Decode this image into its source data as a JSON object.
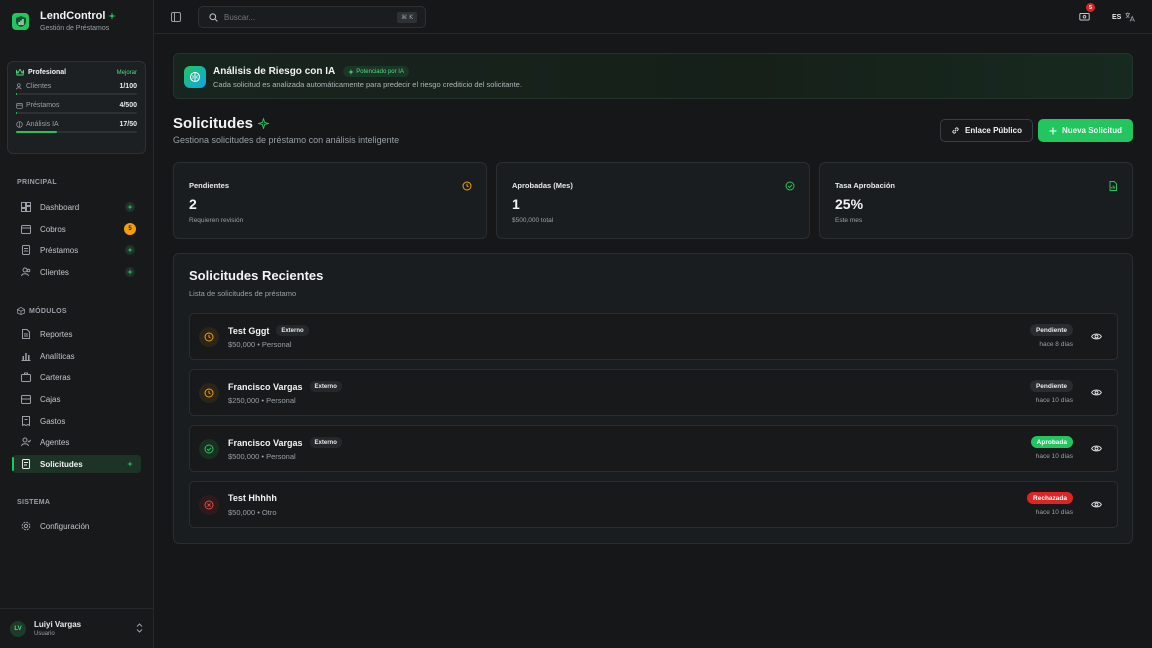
{
  "brand": {
    "name": "LendControl",
    "subtitle": "Gestión de Préstamos"
  },
  "plan": {
    "name": "Profesional",
    "upgrade_label": "Mejorar",
    "usage": [
      {
        "label": "Clientes",
        "value": "1/100",
        "fraction": 0.01
      },
      {
        "label": "Préstamos",
        "value": "4/500",
        "fraction": 0.008
      },
      {
        "label": "Análisis IA",
        "value": "17/50",
        "fraction": 0.34
      }
    ]
  },
  "sidebar": {
    "principal_label": "PRINCIPAL",
    "principal": [
      {
        "label": "Dashboard"
      },
      {
        "label": "Cobros",
        "badge": "5"
      },
      {
        "label": "Préstamos"
      },
      {
        "label": "Clientes"
      }
    ],
    "modulos_label": "MÓDULOS",
    "modulos": [
      {
        "label": "Reportes"
      },
      {
        "label": "Analíticas"
      },
      {
        "label": "Carteras"
      },
      {
        "label": "Cajas"
      },
      {
        "label": "Gastos"
      },
      {
        "label": "Agentes"
      },
      {
        "label": "Solicitudes"
      }
    ],
    "sistema_label": "SISTEMA",
    "sistema": [
      {
        "label": "Configuración"
      }
    ]
  },
  "user": {
    "initials": "LV",
    "name": "Luiyi Vargas",
    "role": "Usuario"
  },
  "topbar": {
    "search_placeholder": "Buscar...",
    "shortcut": "⌘ K",
    "notification_count": "5",
    "language": "ES"
  },
  "banner": {
    "title": "Análisis de Riesgo con IA",
    "chip": "Potenciado por IA",
    "description": "Cada solicitud es analizada automáticamente para predecir el riesgo crediticio del solicitante."
  },
  "page": {
    "title": "Solicitudes",
    "subtitle": "Gestiona solicitudes de préstamo con análisis inteligente",
    "public_link_label": "Enlace Público",
    "new_request_label": "Nueva Solicitud"
  },
  "stats": [
    {
      "title": "Pendientes",
      "value": "2",
      "sub": "Requieren revisión"
    },
    {
      "title": "Aprobadas (Mes)",
      "value": "1",
      "sub": "$500,000 total"
    },
    {
      "title": "Tasa Aprobación",
      "value": "25%",
      "sub": "Este mes"
    }
  ],
  "recent": {
    "title": "Solicitudes Recientes",
    "subtitle": "Lista de solicitudes de préstamo",
    "items": [
      {
        "name": "Test Gggt",
        "tag": "Externo",
        "detail": "$50,000 • Personal",
        "status": "Pendiente",
        "time": "hace 8 días"
      },
      {
        "name": "Francisco Vargas",
        "tag": "Externo",
        "detail": "$250,000 • Personal",
        "status": "Pendiente",
        "time": "hace 10 días"
      },
      {
        "name": "Francisco Vargas",
        "tag": "Externo",
        "detail": "$500,000 • Personal",
        "status": "Aprobada",
        "time": "hace 10 días"
      },
      {
        "name": "Test Hhhhh",
        "tag": "",
        "detail": "$50,000 • Otro",
        "status": "Rechazada",
        "time": "hace 10 días"
      }
    ]
  },
  "colors": {
    "accent": "#22c55e",
    "warning": "#f59e0b",
    "danger": "#dc2626"
  }
}
